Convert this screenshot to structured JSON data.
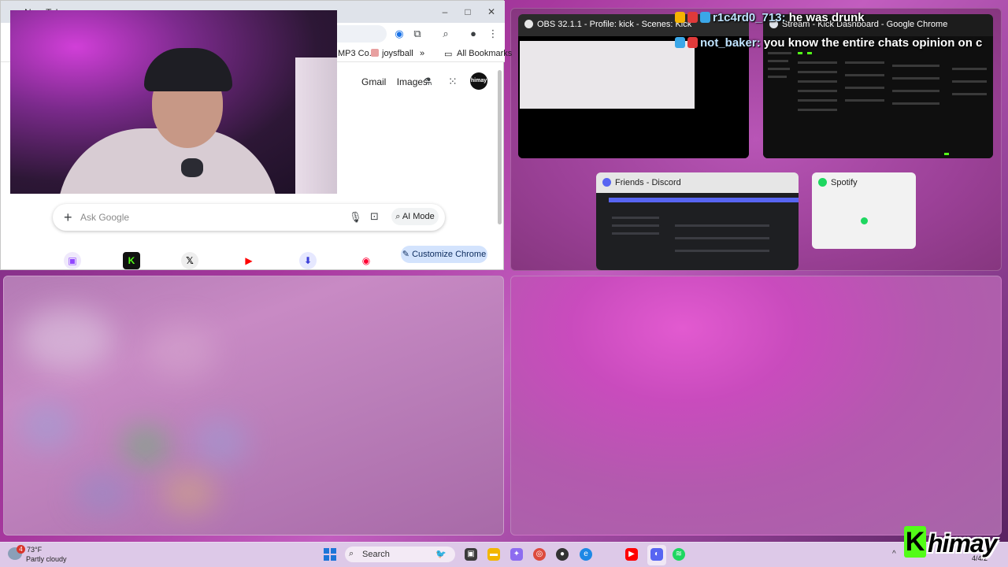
{
  "chrome": {
    "tab_title": "New Tab",
    "bookmarks": {
      "mp3": "MP3 Co...",
      "joysfball": "joysfball",
      "more": "»",
      "all": "All Bookmarks"
    },
    "links": {
      "gmail": "Gmail",
      "images": "Images"
    },
    "avatar_text": "himay",
    "search_placeholder": "Ask Google",
    "ai_mode": "AI Mode",
    "customize": "Customize Chrome",
    "shortcuts": [
      "twitch-icon",
      "kick-icon",
      "x-icon",
      "youtube-icon",
      "downloader-icon",
      "youtube-music-icon"
    ]
  },
  "task_view": {
    "obs_title": "OBS 32.1.1 - Profile: kick - Scenes: Kick",
    "kick_title": "Stream - Kick Dashboard - Google Chrome",
    "discord_title": "Friends - Discord",
    "spotify_title": "Spotify"
  },
  "chat": [
    {
      "user": "r1c4rd0_713:",
      "message": "he was drunk"
    },
    {
      "user": "not_baker:",
      "message": "you know the entire chats opinion on c"
    }
  ],
  "taskbar": {
    "weather_temp": "73°F",
    "weather_condition": "Partly cloudy",
    "weather_badge": "4",
    "search_label": "Search",
    "date": "4/4/2"
  },
  "overlay": {
    "brand": "himay",
    "brand_initial": "K"
  },
  "colors": {
    "kick_green": "#53fc18",
    "chrome_accent": "#d3e3fd",
    "discord": "#5865f2",
    "spotify": "#1ed760"
  }
}
